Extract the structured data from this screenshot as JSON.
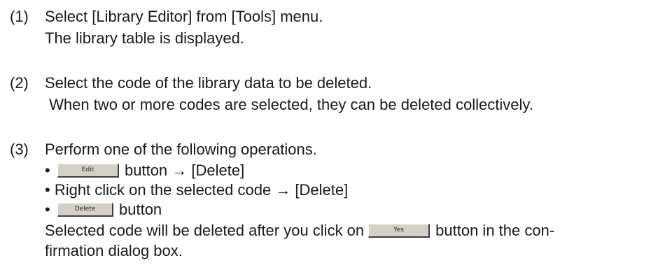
{
  "steps": [
    {
      "num": "(1)",
      "lines": [
        "Select [Library Editor] from [Tools] menu.",
        "The library table is displayed."
      ]
    },
    {
      "num": "(2)",
      "lines": [
        "Select the code of the library data to be deleted.",
        " When two or more codes are selected, they can be deleted collectively."
      ]
    },
    {
      "num": "(3)",
      "intro": "Perform one of the following operations.",
      "bullets": {
        "b1_button": "Edit",
        "b1_text": "button → [Delete]",
        "b2_text": "• Right click on the selected code → [Delete]",
        "b3_button": "Delete",
        "b3_text": "button"
      },
      "confirm_pre": "Selected code will be deleted after you click on",
      "confirm_button": "Yes",
      "confirm_post": "button in the con-",
      "confirm_tail": "firmation dialog box."
    }
  ]
}
